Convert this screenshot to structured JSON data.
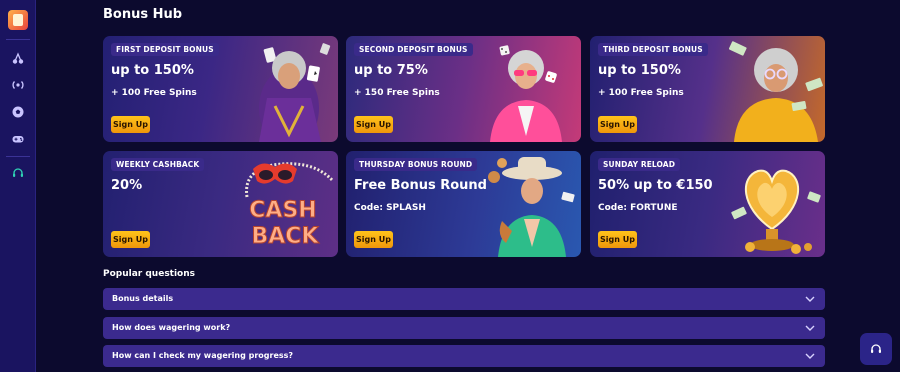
{
  "page": {
    "title": "Bonus Hub"
  },
  "sidebar": {
    "icons": [
      "logo-icon",
      "cherries-icon",
      "broadcast-icon",
      "soccer-ball-icon",
      "gamepad-icon",
      "headset-icon"
    ]
  },
  "cards": [
    {
      "badge": "FIRST DEPOSIT BONUS",
      "headline": "up to 150%",
      "sub": "+ 100 Free Spins",
      "button": "Sign Up"
    },
    {
      "badge": "SECOND DEPOSIT BONUS",
      "headline": "up to 75%",
      "sub": "+ 150 Free Spins",
      "button": "Sign Up"
    },
    {
      "badge": "THIRD DEPOSIT BONUS",
      "headline": "up to 150%",
      "sub": "+ 100 Free Spins",
      "button": "Sign Up"
    },
    {
      "badge": "WEEKLY CASHBACK",
      "headline": "20%",
      "sub": "",
      "button": "Sign Up",
      "art_text": [
        "CASH",
        "BACK"
      ]
    },
    {
      "badge": "THURSDAY BONUS ROUND",
      "headline": "Free Bonus Round",
      "sub": "Code: SPLASH",
      "button": "Sign Up"
    },
    {
      "badge": "SUNDAY RELOAD",
      "headline": "50% up to €150",
      "sub": "Code: FORTUNE",
      "button": "Sign Up"
    }
  ],
  "faq": {
    "title": "Popular questions",
    "items": [
      {
        "question": "Bonus details"
      },
      {
        "question": "How does wagering work?"
      },
      {
        "question": "How can I check my wagering progress?"
      }
    ]
  },
  "colors": {
    "background": "#0c0a2e",
    "sidebar": "#1a1460",
    "button": "#ffb012",
    "faq_row": "#3b2a8e",
    "support_button": "#2b2488"
  }
}
